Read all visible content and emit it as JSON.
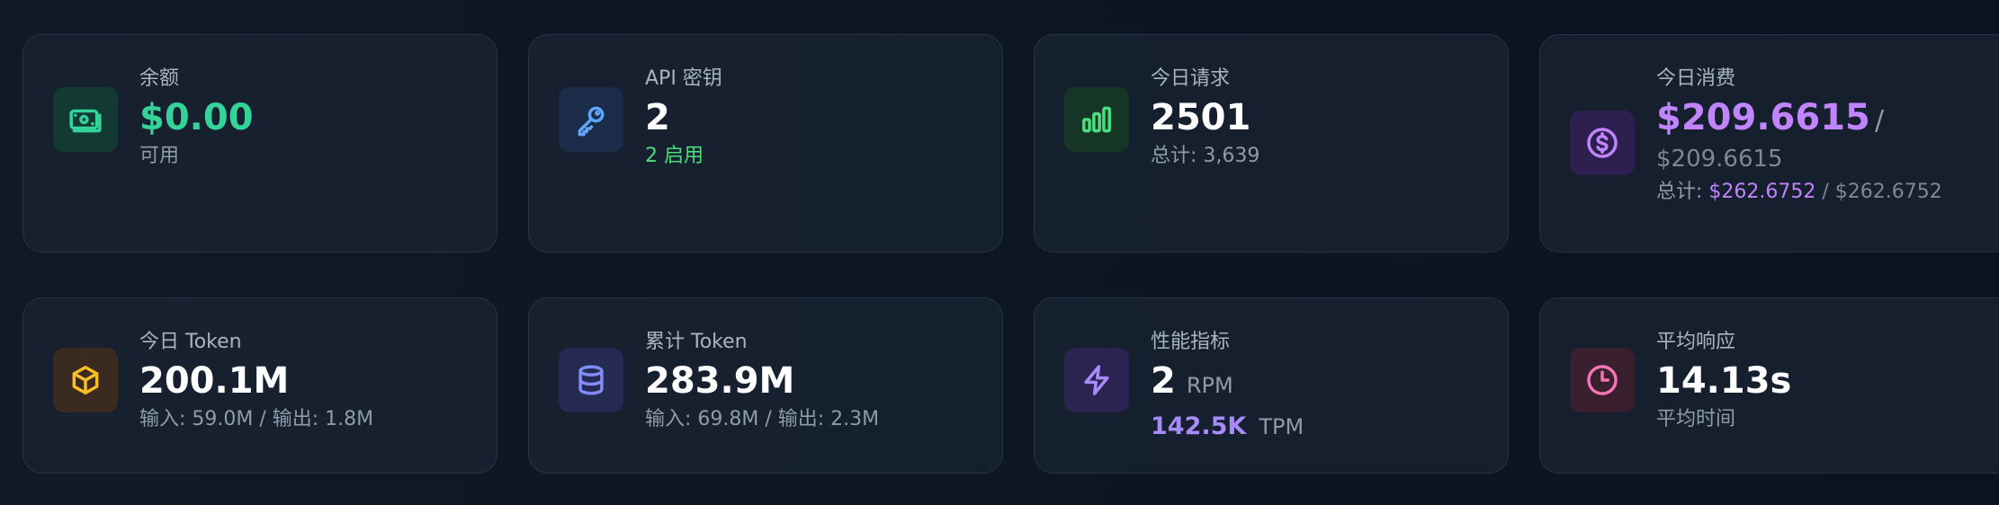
{
  "cards": [
    {
      "id": "balance",
      "label": "余额",
      "value": "$0.00",
      "sub": "可用",
      "icon": "banknote-icon",
      "color": "#34d399"
    },
    {
      "id": "api_keys",
      "label": "API 密钥",
      "value": "2",
      "sub": "2 启用",
      "icon": "key-icon",
      "color": "#60a5fa"
    },
    {
      "id": "today_requests",
      "label": "今日请求",
      "value": "2501",
      "sub": "总计: 3,639",
      "icon": "bar-chart-icon",
      "color": "#4ade80"
    },
    {
      "id": "today_cost",
      "label": "今日消费",
      "value": "$209.6615",
      "value_sep": "/",
      "value_total": "$209.6615",
      "sub_prefix": "总计: ",
      "sub_value": "$262.6752",
      "sub_sep": " / ",
      "sub_total": "$262.6752",
      "icon": "dollar-circle-icon",
      "color": "#c084fc"
    },
    {
      "id": "today_tokens",
      "label": "今日 Token",
      "value": "200.1M",
      "sub": "输入: 59.0M / 输出: 1.8M",
      "icon": "cube-icon",
      "color": "#fbbf24"
    },
    {
      "id": "total_tokens",
      "label": "累计 Token",
      "value": "283.9M",
      "sub": "输入: 69.8M / 输出: 2.3M",
      "icon": "database-icon",
      "color": "#818cf8"
    },
    {
      "id": "performance",
      "label": "性能指标",
      "value": "2",
      "value_unit": "RPM",
      "tpm_value": "142.5K",
      "tpm_unit": "TPM",
      "icon": "lightning-icon",
      "color": "#a78bfa"
    },
    {
      "id": "avg_response",
      "label": "平均响应",
      "value": "14.13s",
      "sub": "平均时间",
      "icon": "clock-icon",
      "color": "#f472b6"
    }
  ]
}
